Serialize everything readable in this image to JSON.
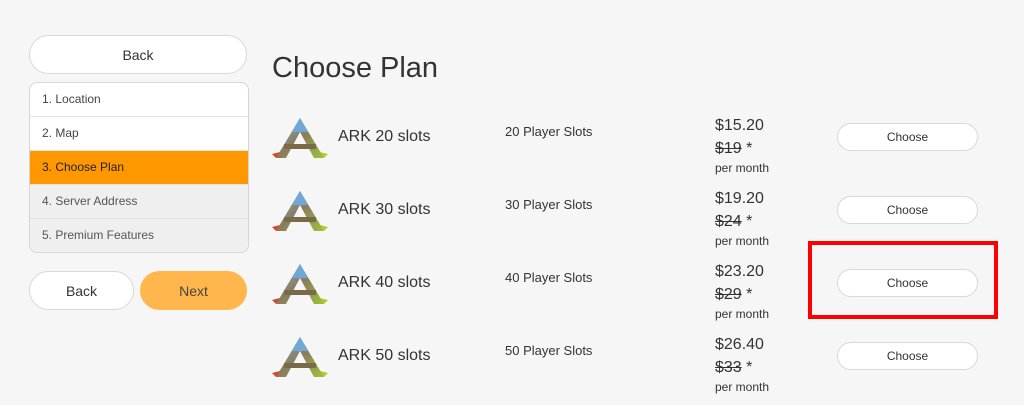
{
  "sidebar": {
    "top_back_label": "Back",
    "steps": [
      {
        "label": "1. Location"
      },
      {
        "label": "2. Map"
      },
      {
        "label": "3. Choose Plan"
      },
      {
        "label": "4. Server Address"
      },
      {
        "label": "5. Premium Features"
      }
    ],
    "back_label": "Back",
    "next_label": "Next"
  },
  "main": {
    "title": "Choose Plan",
    "plans": [
      {
        "name": "ARK 20 slots",
        "slots": "20 Player Slots",
        "price": "$15.20",
        "old_price": "$19",
        "old_suffix": " *",
        "period": "per month",
        "button": "Choose"
      },
      {
        "name": "ARK 30 slots",
        "slots": "30 Player Slots",
        "price": "$19.20",
        "old_price": "$24",
        "old_suffix": " *",
        "period": "per month",
        "button": "Choose"
      },
      {
        "name": "ARK 40 slots",
        "slots": "40 Player Slots",
        "price": "$23.20",
        "old_price": "$29",
        "old_suffix": " *",
        "period": "per month",
        "button": "Choose"
      },
      {
        "name": "ARK 50 slots",
        "slots": "50 Player Slots",
        "price": "$26.40",
        "old_price": "$33",
        "old_suffix": " *",
        "period": "per month",
        "button": "Choose"
      }
    ]
  },
  "colors": {
    "active_step": "#ff9800",
    "next_button": "#ffb74d",
    "highlight": "#ff0000"
  }
}
